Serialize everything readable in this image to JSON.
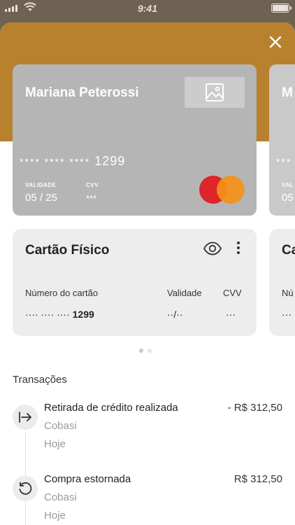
{
  "status_bar": {
    "time": "9:41"
  },
  "cards": [
    {
      "holder": "Mariana Peterossi",
      "number_mask": "**** **** ****",
      "number_last": "1299",
      "validity_label": "VALIDADE",
      "validity_value": "05 / 25",
      "cvv_label": "CVV",
      "cvv_value": "***",
      "brand_icon": "mastercard-logo",
      "colors": {
        "card_bg": "#b5b5b5",
        "mc_red": "#e0242c",
        "mc_orange": "#f39217"
      }
    },
    {
      "holder_peek": "M",
      "number_peek": "***",
      "validity_label_peek": "VAL",
      "validity_value_peek": "05"
    }
  ],
  "card_details": [
    {
      "title": "Cartão Físico",
      "number_label": "Número do cartão",
      "number_masked": "···· ···· ····",
      "number_last": "1299",
      "validity_label": "Validade",
      "validity_value": "··/··",
      "cvv_label": "CVV",
      "cvv_value": "···"
    },
    {
      "title_peek": "Ca",
      "number_label_peek": "Nú",
      "number_value_peek": "···"
    }
  ],
  "transactions": {
    "title": "Transações",
    "items": [
      {
        "icon": "withdraw-icon",
        "title": "Retirada de crédito realizada",
        "merchant": "Cobasi",
        "date": "Hoje",
        "amount": "- R$ 312,50"
      },
      {
        "icon": "refund-icon",
        "title": "Compra estornada",
        "merchant": "Cobasi",
        "date": "Hoje",
        "amount": "R$ 312,50"
      }
    ]
  },
  "colors": {
    "header": "#b8812e",
    "backdrop": "#6e6253",
    "info_card_bg": "#ededee"
  }
}
